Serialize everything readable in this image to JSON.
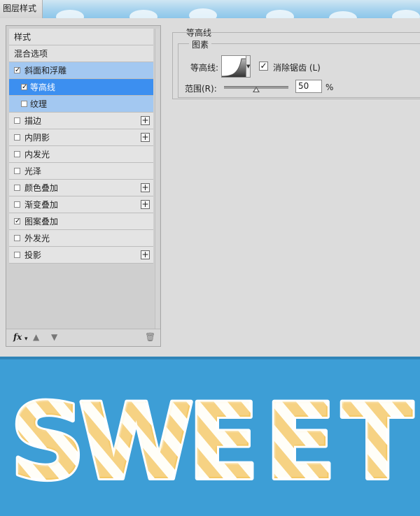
{
  "window": {
    "title": "图层样式"
  },
  "left_panel": {
    "items": [
      {
        "label": "样式",
        "type": "header"
      },
      {
        "label": "混合选项",
        "type": "header"
      },
      {
        "label": "斜面和浮雕",
        "checked": true,
        "state": "sel-light"
      },
      {
        "label": "等高线",
        "checked": true,
        "state": "sel-dark",
        "indent": true
      },
      {
        "label": "纹理",
        "checked": false,
        "state": "sel-light",
        "indent": true
      },
      {
        "label": "描边",
        "checked": false,
        "plus": true
      },
      {
        "label": "内阴影",
        "checked": false,
        "plus": true
      },
      {
        "label": "内发光",
        "checked": false
      },
      {
        "label": "光泽",
        "checked": false
      },
      {
        "label": "颜色叠加",
        "checked": false,
        "plus": true
      },
      {
        "label": "渐变叠加",
        "checked": false,
        "plus": true
      },
      {
        "label": "图案叠加",
        "checked": true
      },
      {
        "label": "外发光",
        "checked": false
      },
      {
        "label": "投影",
        "checked": false,
        "plus": true
      }
    ],
    "toolbar": {
      "fx_label": "fx",
      "up_icon": "arrow-up-icon",
      "down_icon": "arrow-down-icon",
      "trash_icon": "trash-icon"
    }
  },
  "contour_section": {
    "title": "等高线",
    "group_title": "图素",
    "contour_label": "等高线:",
    "antialias_label": "消除锯齿 (L)",
    "antialias_checked": true,
    "range_label": "范围(R):",
    "range_value": "50",
    "range_percent": 50,
    "range_unit": "%"
  },
  "preview": {
    "letters": [
      "S",
      "W",
      "E",
      "E",
      "T"
    ],
    "background_color": "#3d9ed6"
  }
}
